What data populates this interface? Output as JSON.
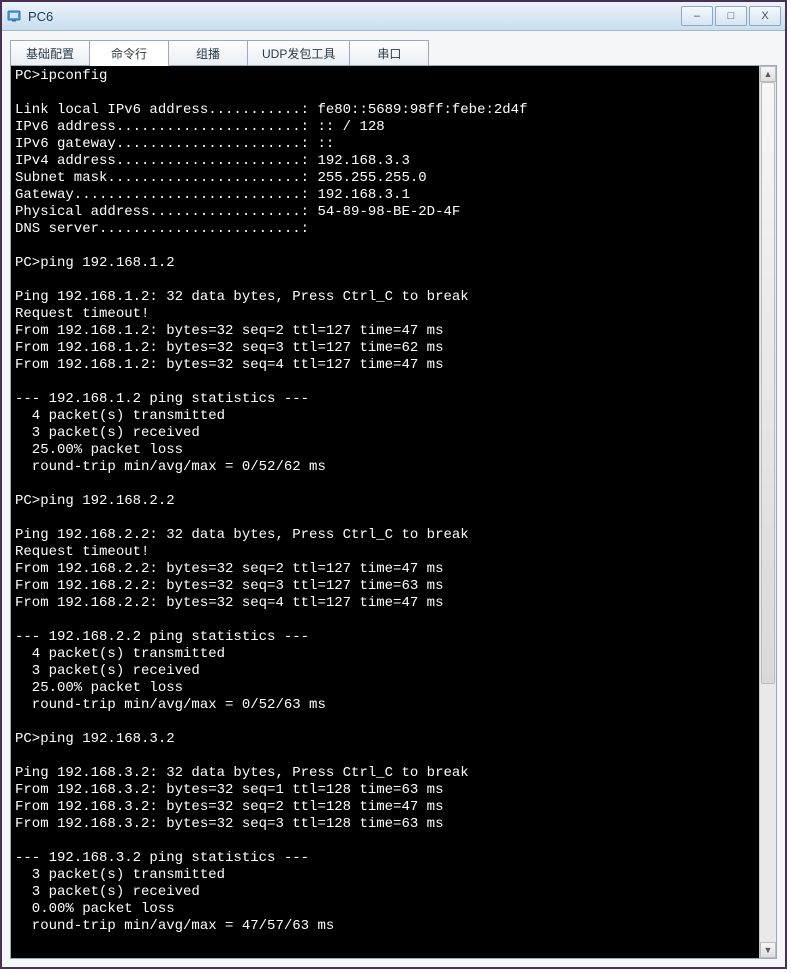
{
  "window": {
    "title": "PC6",
    "controls": {
      "minimize": "–",
      "maximize": "□",
      "close": "X"
    }
  },
  "tabs": [
    {
      "id": "basic",
      "label": "基础配置",
      "active": false
    },
    {
      "id": "cmd",
      "label": "命令行",
      "active": true
    },
    {
      "id": "mcast",
      "label": "组播",
      "active": false
    },
    {
      "id": "udp",
      "label": "UDP发包工具",
      "active": false
    },
    {
      "id": "serial",
      "label": "串口",
      "active": false
    }
  ],
  "terminal": {
    "prompt": "PC>",
    "lines": [
      "PC>ipconfig",
      "",
      "Link local IPv6 address...........: fe80::5689:98ff:febe:2d4f",
      "IPv6 address......................: :: / 128",
      "IPv6 gateway......................: ::",
      "IPv4 address......................: 192.168.3.3",
      "Subnet mask.......................: 255.255.255.0",
      "Gateway...........................: 192.168.3.1",
      "Physical address..................: 54-89-98-BE-2D-4F",
      "DNS server........................:",
      "",
      "PC>ping 192.168.1.2",
      "",
      "Ping 192.168.1.2: 32 data bytes, Press Ctrl_C to break",
      "Request timeout!",
      "From 192.168.1.2: bytes=32 seq=2 ttl=127 time=47 ms",
      "From 192.168.1.2: bytes=32 seq=3 ttl=127 time=62 ms",
      "From 192.168.1.2: bytes=32 seq=4 ttl=127 time=47 ms",
      "",
      "--- 192.168.1.2 ping statistics ---",
      "  4 packet(s) transmitted",
      "  3 packet(s) received",
      "  25.00% packet loss",
      "  round-trip min/avg/max = 0/52/62 ms",
      "",
      "PC>ping 192.168.2.2",
      "",
      "Ping 192.168.2.2: 32 data bytes, Press Ctrl_C to break",
      "Request timeout!",
      "From 192.168.2.2: bytes=32 seq=2 ttl=127 time=47 ms",
      "From 192.168.2.2: bytes=32 seq=3 ttl=127 time=63 ms",
      "From 192.168.2.2: bytes=32 seq=4 ttl=127 time=47 ms",
      "",
      "--- 192.168.2.2 ping statistics ---",
      "  4 packet(s) transmitted",
      "  3 packet(s) received",
      "  25.00% packet loss",
      "  round-trip min/avg/max = 0/52/63 ms",
      "",
      "PC>ping 192.168.3.2",
      "",
      "Ping 192.168.3.2: 32 data bytes, Press Ctrl_C to break",
      "From 192.168.3.2: bytes=32 seq=1 ttl=128 time=63 ms",
      "From 192.168.3.2: bytes=32 seq=2 ttl=128 time=47 ms",
      "From 192.168.3.2: bytes=32 seq=3 ttl=128 time=63 ms",
      "",
      "--- 192.168.3.2 ping statistics ---",
      "  3 packet(s) transmitted",
      "  3 packet(s) received",
      "  0.00% packet loss",
      "  round-trip min/avg/max = 47/57/63 ms",
      ""
    ]
  }
}
